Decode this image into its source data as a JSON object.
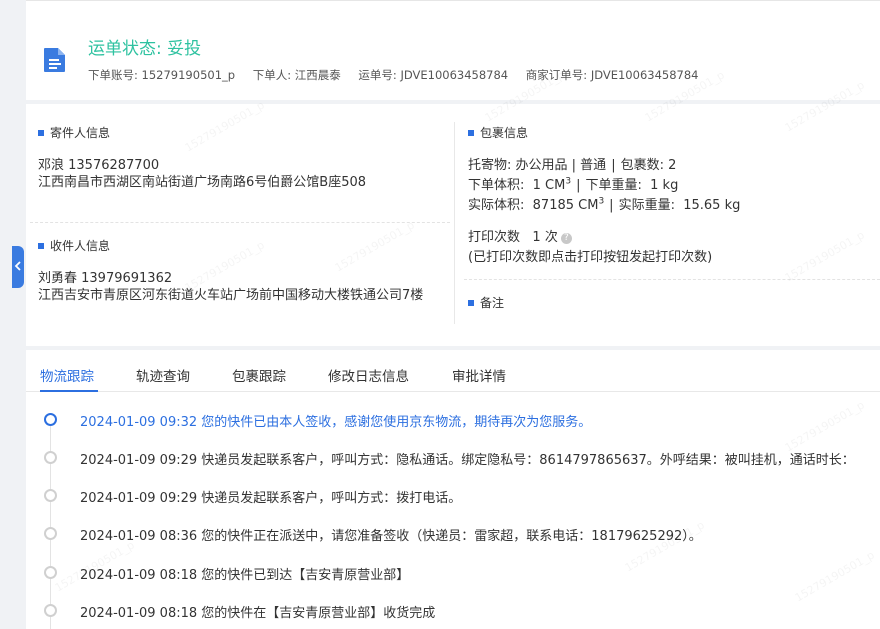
{
  "header": {
    "status_title": "运单状态: 妥投",
    "order_account_label": "下单账号:",
    "order_account": "15279190501_p",
    "orderer_label": "下单人:",
    "orderer": "江西晨泰",
    "waybill_label": "运单号:",
    "waybill": "JDVE10063458784",
    "merchant_order_label": "商家订单号:",
    "merchant_order": "JDVE10063458784",
    "icon": "document-icon"
  },
  "sender": {
    "title": "寄件人信息",
    "name_phone": "邓浪   13576287700",
    "address": "江西南昌市西湖区南站街道广场南路6号伯爵公馆B座508"
  },
  "receiver": {
    "title": "收件人信息",
    "name_phone": "刘勇春   13979691362",
    "address": "江西吉安市青原区河东街道火车站广场前中国移动大楼铁通公司7楼"
  },
  "package": {
    "title": "包裹信息",
    "goods_label": "托寄物:",
    "goods": "办公用品 | 普通",
    "count_label": "包裹数:",
    "count": "2",
    "order_volume_label": "下单体积:",
    "order_volume": "1 CM",
    "order_weight_label": "下单重量:",
    "order_weight": "1 kg",
    "actual_volume_label": "实际体积:",
    "actual_volume": "87185 CM",
    "actual_weight_label": "实际重量:",
    "actual_weight": "15.65 kg",
    "volume_sup": "3",
    "print_label": "打印次数",
    "print_count": "1 次",
    "print_note": "(已打印次数即点击打印按钮发起打印次数)"
  },
  "remark": {
    "title": "备注"
  },
  "tabs": [
    {
      "label": "物流跟踪",
      "active": true
    },
    {
      "label": "轨迹查询",
      "active": false
    },
    {
      "label": "包裹跟踪",
      "active": false
    },
    {
      "label": "修改日志信息",
      "active": false
    },
    {
      "label": "审批详情",
      "active": false
    }
  ],
  "timeline": [
    {
      "text": "2024-01-09 09:32 您的快件已由本人签收，感谢您使用京东物流，期待再次为您服务。",
      "active": true
    },
    {
      "text": "2024-01-09 09:29 快递员发起联系客户，呼叫方式：隐私通话。绑定隐私号：8614797865637。外呼结果：被叫挂机，通话时长：",
      "active": false
    },
    {
      "text": "2024-01-09 09:29 快递员发起联系客户，呼叫方式：拨打电话。",
      "active": false
    },
    {
      "text": "2024-01-09 08:36 您的快件正在派送中，请您准备签收（快递员：雷家超，联系电话：18179625292）。",
      "active": false
    },
    {
      "text": "2024-01-09 08:18 您的快件已到达【吉安青原营业部】",
      "active": false
    },
    {
      "text": "2024-01-09 08:18 您的快件在【吉安青原营业部】收货完成",
      "active": false
    }
  ],
  "watermark": "15279190501_p",
  "colors": {
    "accent": "#2c6fe0",
    "status_green": "#2ec2a0"
  }
}
